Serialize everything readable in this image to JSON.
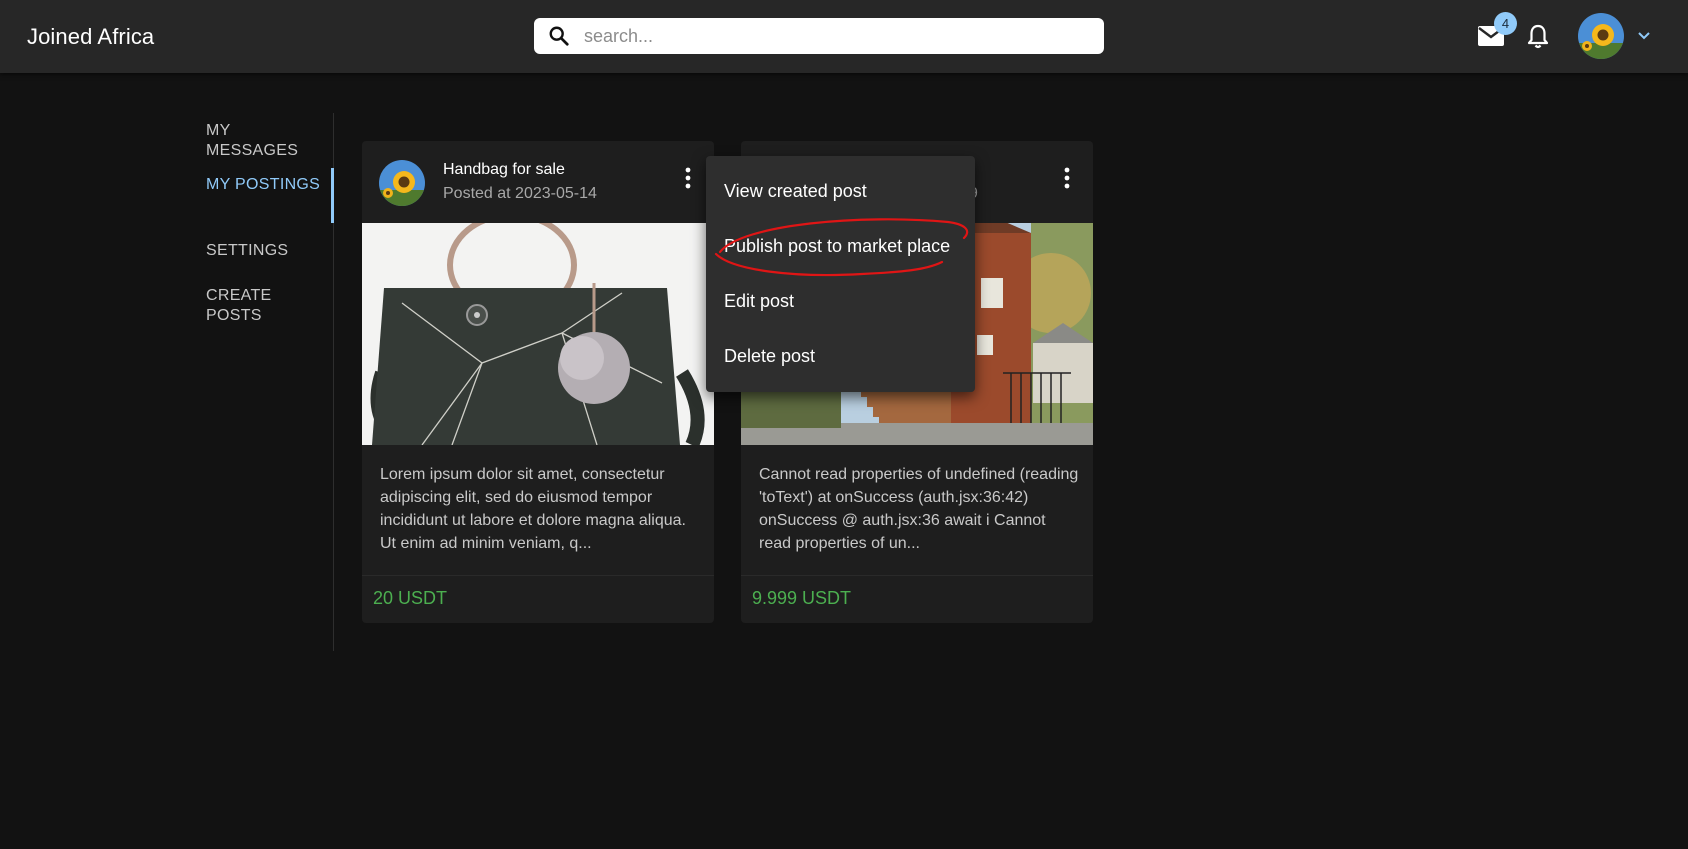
{
  "app": {
    "title": "Joined Africa"
  },
  "search": {
    "placeholder": "search...",
    "value": ""
  },
  "header": {
    "mail_badge_count": "4",
    "icons": [
      "search-icon",
      "mail-icon",
      "bell-icon",
      "avatar",
      "chevron-down-icon"
    ]
  },
  "sidebar": {
    "items": [
      {
        "label": "MY MESSAGES",
        "active": false
      },
      {
        "label": "MY POSTINGS",
        "active": true
      },
      {
        "label": "SETTINGS",
        "active": false
      },
      {
        "label": "CREATE POSTS",
        "active": false
      }
    ]
  },
  "posts": [
    {
      "title": "Handbag for sale",
      "posted": "Posted at 2023-05-14",
      "description": "Lorem ipsum dolor sit amet, consectetur adipiscing elit, sed do eiusmod tempor incididunt ut labore et dolore magna aliqua. Ut enim ad minim veniam, q...",
      "price": "20 USDT"
    },
    {
      "posted_suffix": "9",
      "description": "Cannot read properties of undefined (reading 'toText') at onSuccess (auth.jsx:36:42) onSuccess @ auth.jsx:36 await i Cannot read properties of un...",
      "price": "9.999 USDT"
    }
  ],
  "menu": {
    "items": [
      "View created post",
      "Publish post to market place",
      "Edit post",
      "Delete post"
    ],
    "highlighted": "Publish post to market place"
  },
  "colors": {
    "appbar": "#272727",
    "background": "#121212",
    "accent": "#90caf9",
    "price": "#4caf50",
    "annotation": "#e01515"
  }
}
